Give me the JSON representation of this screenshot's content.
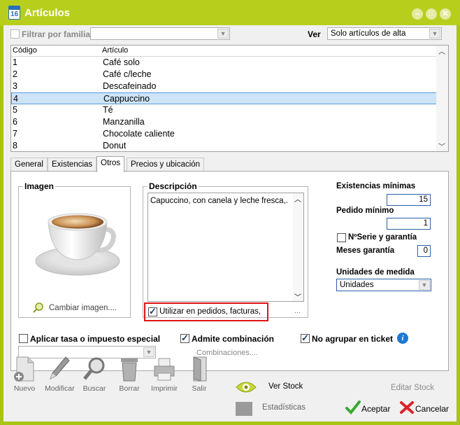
{
  "window": {
    "title": "Artículos",
    "icon_text": "16",
    "buttons": [
      "minimize",
      "maximize",
      "close"
    ]
  },
  "filter": {
    "family_label": "Filtrar por familia",
    "family_checked": false,
    "family_value": "",
    "ver_label": "Ver",
    "ver_value": "Solo artículos de alta"
  },
  "grid": {
    "columns": [
      "Código",
      "Artículo"
    ],
    "rows": [
      {
        "code": "1",
        "name": "Café solo"
      },
      {
        "code": "2",
        "name": "Café c/leche"
      },
      {
        "code": "3",
        "name": "Descafeinado"
      },
      {
        "code": "4",
        "name": "Cappuccino"
      },
      {
        "code": "5",
        "name": "Té"
      },
      {
        "code": "6",
        "name": "Manzanilla"
      },
      {
        "code": "7",
        "name": "Chocolate caliente"
      },
      {
        "code": "8",
        "name": "Donut"
      }
    ],
    "selected_index": 3
  },
  "tabs": [
    "General",
    "Existencias",
    "Otros",
    "Precios y ubicación"
  ],
  "active_tab": "Otros",
  "imagen": {
    "title": "Imagen",
    "change_label": "Cambiar imagen...."
  },
  "descripcion": {
    "title": "Descripción",
    "text": "Capuccino, con canela y leche fresca,.",
    "use_label": "Utilizar en pedidos, facturas,",
    "use_checked": true,
    "ellipsis": "..."
  },
  "stock": {
    "min_label": "Existencias mínimas",
    "min_value": "15",
    "pedido_label": "Pedido mínimo",
    "pedido_value": "1",
    "serie_label": "NºSerie y garantía",
    "serie_checked": false,
    "meses_label": "Meses garantía",
    "meses_value": "0",
    "unidades_label": "Unidades de medida",
    "unidades_value": "Unidades"
  },
  "options": {
    "tasa_label": "Aplicar tasa o impuesto especial",
    "tasa_checked": false,
    "tasa_value": "",
    "combinacion_label": "Admite combinación",
    "combinacion_checked": true,
    "combinaciones_link": "Combinaciones....",
    "agrupar_label": "No  agrupar en ticket",
    "agrupar_checked": true
  },
  "toolbar": {
    "nuevo": "Nuevo",
    "modificar": "Modificar",
    "buscar": "Buscar",
    "borrar": "Borrar",
    "imprimir": "Imprimir",
    "salir": "Salir",
    "ver_stock": "Ver Stock",
    "estadisticas": "Estadísticas",
    "editar_stock": "Editar Stock",
    "aceptar": "Aceptar",
    "cancelar": "Cancelar"
  },
  "colors": {
    "accent": "#b7cf1c",
    "selection": "#cde4f7",
    "highlight": "#e01414"
  }
}
